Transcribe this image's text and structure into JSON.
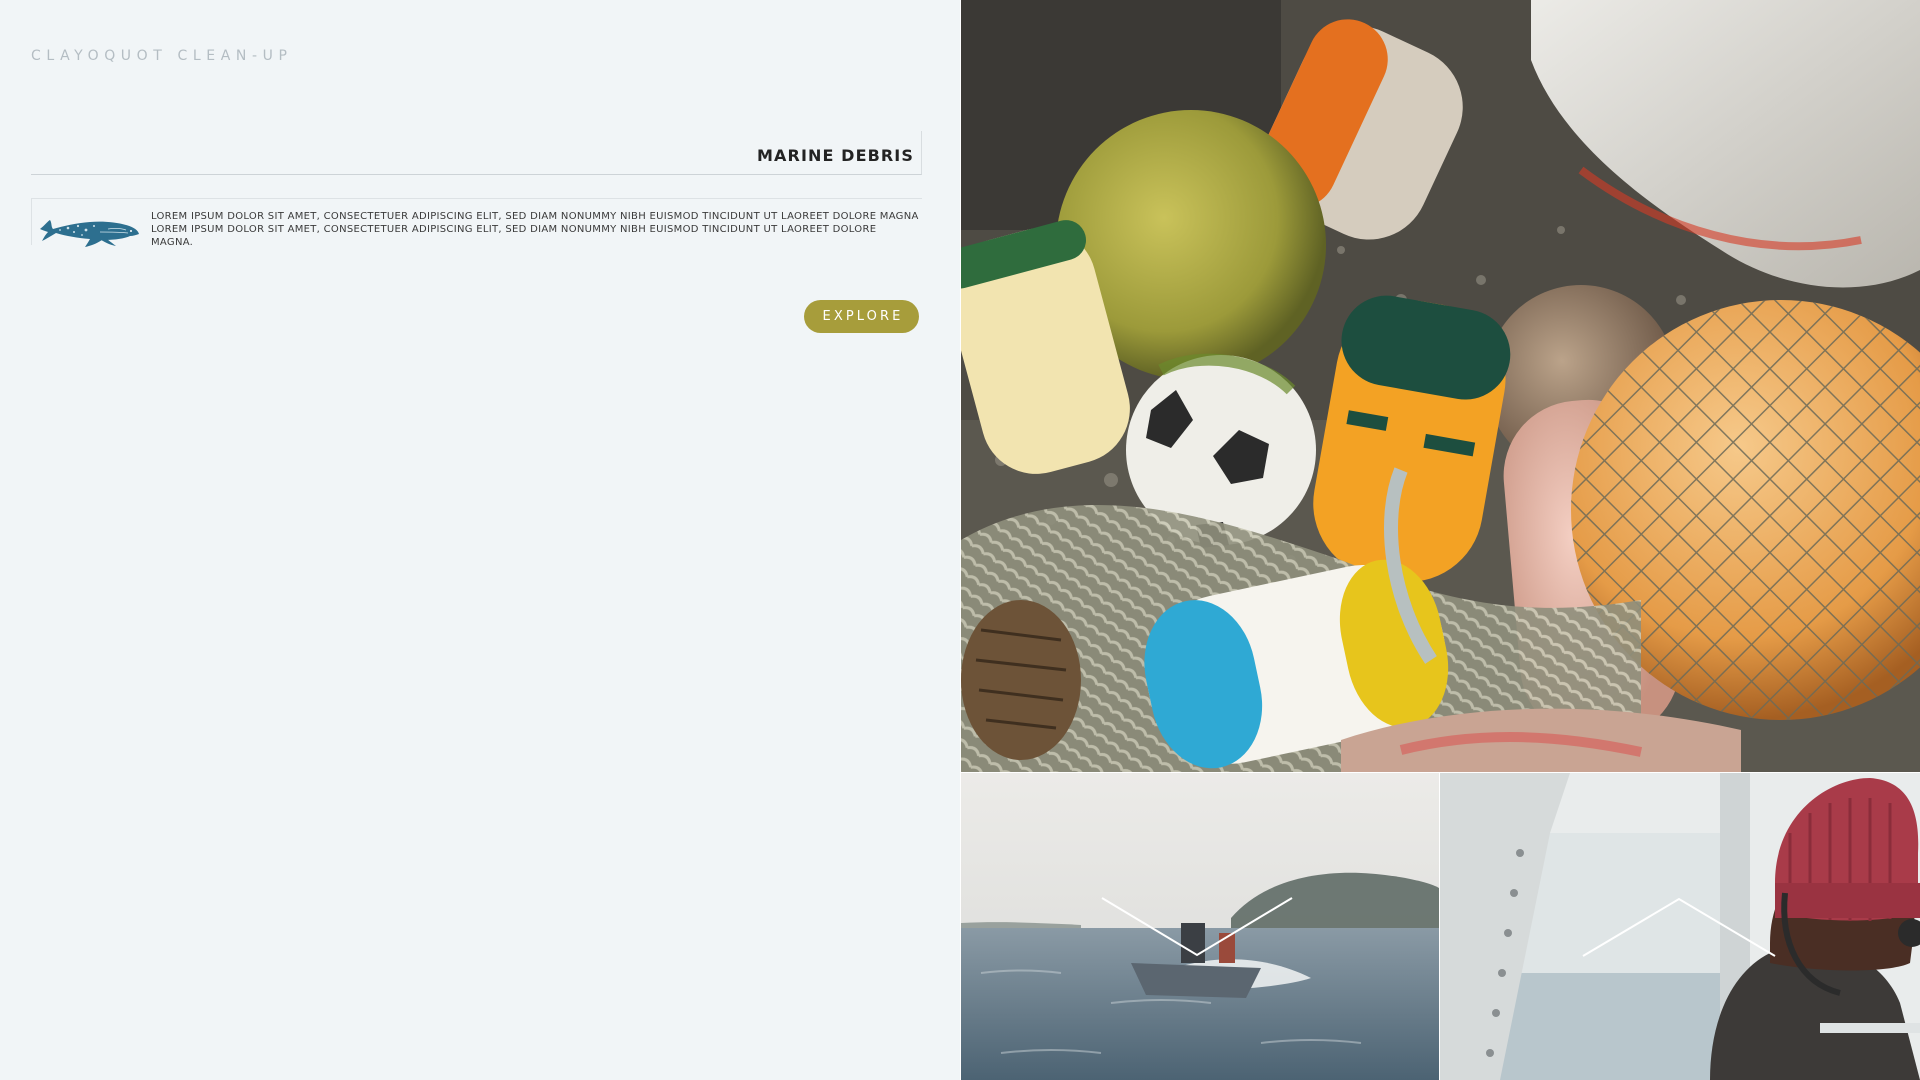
{
  "brand": {
    "name": "CLAYOQUOT CLEAN-UP"
  },
  "section": {
    "title": "MARINE DEBRIS",
    "description": "LOREM IPSUM DOLOR SIT AMET, CONSECTETUER ADIPISCING ELIT, SED DIAM NONUMMY NIBH EUISMOD TINCIDUNT UT LAOREET DOLORE MAGNA LOREM IPSUM DOLOR SIT AMET, CONSECTETUER ADIPISCING ELIT, SED DIAM NONUMMY NIBH EUISMOD TINCIDUNT UT LAOREET DOLORE MAGNA.",
    "explore_label": "EXPLORE"
  },
  "gallery": {
    "photos": [
      {
        "subject": "buoys-and-floats-on-beach"
      },
      {
        "subject": "speedboat-on-sea",
        "nav_icon": "chevron-down-icon"
      },
      {
        "subject": "person-in-red-beanie-on-boat",
        "nav_icon": "chevron-up-icon"
      }
    ]
  },
  "colors": {
    "background": "#f1f5f7",
    "accent": "#a79d3b",
    "whale": "#2d6f8f",
    "brand_text": "#b4bdc3",
    "title_text": "#232323"
  },
  "icons": {
    "logo": "whale-icon"
  }
}
